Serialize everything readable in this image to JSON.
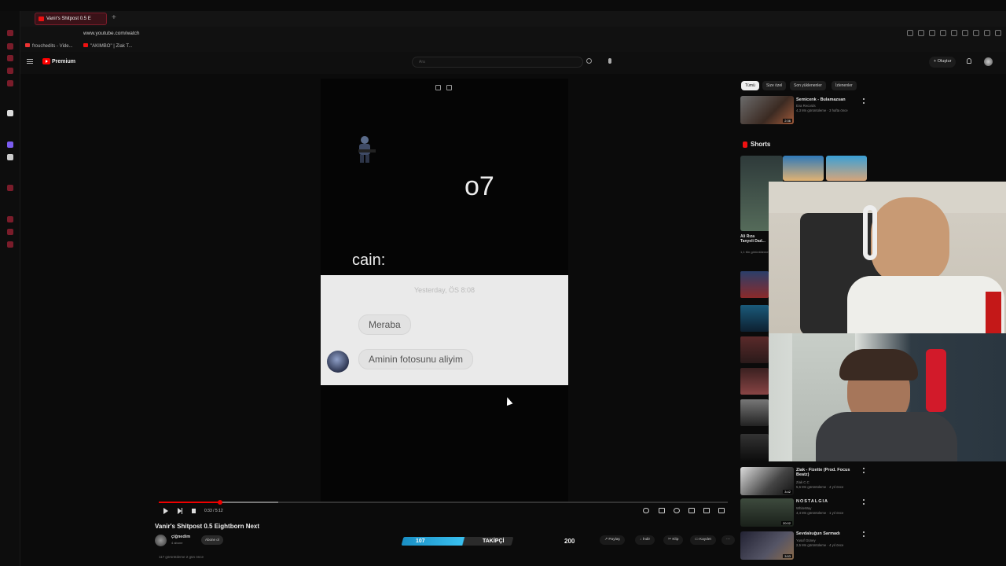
{
  "browser": {
    "tab_title": "Vanir's Shitpost 0.5 E",
    "url": "www.youtube.com/watch",
    "bookmarks": [
      "frouchedits - Vide...",
      "\"AKIMBO\" | Ziak T..."
    ]
  },
  "youtube": {
    "brand": "Premium",
    "search_placeholder": "Ara",
    "create_label": "Oluştur"
  },
  "video": {
    "overlay_o7": "o7",
    "overlay_cain": "cain:",
    "chat_time": "Yesterday, ÖS 8:08",
    "msg1": "Meraba",
    "msg2": "Aminin fotosunu aliyim",
    "progress": 0.108,
    "time_text": "0:33 / 5:12"
  },
  "below": {
    "title": "Vanir's Shitpost 0.5 Eightborn Next",
    "channel": "çiğnedim",
    "subs": "4 abone",
    "subscribe": "Abone ol",
    "overlay_left": "107",
    "overlay_right": "TAKİPÇİ",
    "overlay_count": "200",
    "actions": [
      "Paylaş",
      "İndir",
      "Klip",
      "Kaydet"
    ],
    "views": "117 görüntüleme  2 gün önce"
  },
  "sidebar": {
    "chips": [
      "Tümü",
      "Size özel",
      "Son yüklenenler",
      "İzlenenler"
    ],
    "rec1": {
      "title": "Semicenk - Bulamazsan",
      "channel": "Eva Records",
      "meta": "4,3 Mn görüntüleme · 3 hafta önce",
      "duration": "2:36"
    },
    "shorts_label": "Shorts",
    "short_caption": "Ali Rıza Tanyeli Dad...",
    "short_meta": "1,1 Mn görüntüleme",
    "rec2": {
      "title": "Ziak - Fizette (Prod. Focus Beatz)",
      "channel": "Ziak C.C",
      "meta": "5,6 Mn görüntüleme · 4 yıl önce",
      "duration": "3:42"
    },
    "rec3": {
      "title": "NOSTALGIA",
      "channel": "WhiteWay",
      "meta": "4,4 Mn görüntüleme · 1 yıl önce",
      "duration": "20:02"
    },
    "rec4": {
      "title": "Sevdalıuğun Sarmadı",
      "channel": "Yusuf Güney",
      "meta": "2,5 Mn görüntüleme · 4 yıl önce",
      "duration": "3:53"
    }
  },
  "colors": {
    "accent": "#ff0000",
    "overlay_blue": "#39c0f0"
  }
}
